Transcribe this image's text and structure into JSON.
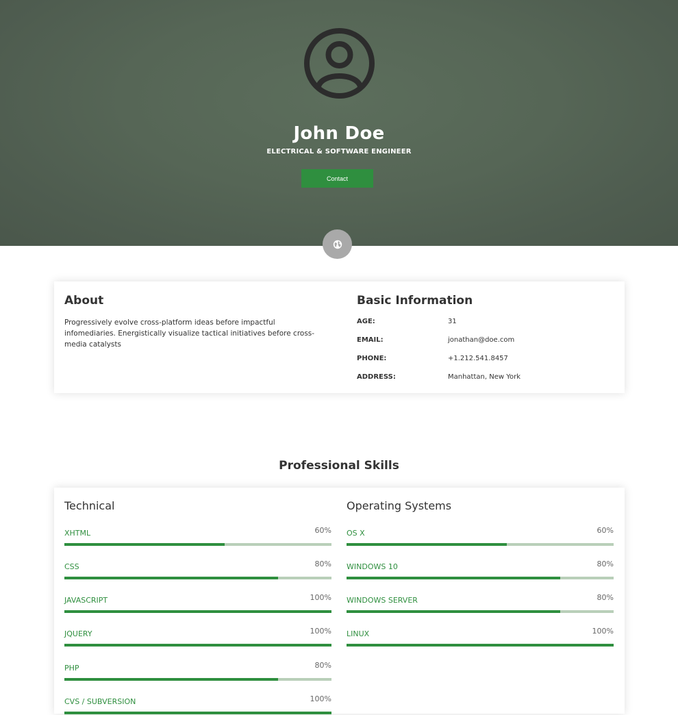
{
  "profile": {
    "name": "John Doe",
    "title": "ELECTRICAL & SOFTWARE ENGINEER",
    "contact_label": "Contact",
    "avatar_icon": "user-circle-icon",
    "globe_icon": "globe-icon"
  },
  "about": {
    "heading": "About",
    "text": "Progressively evolve cross-platform ideas before impactful infomediaries. Energistically visualize tactical initiatives before cross-media catalysts"
  },
  "basic_info": {
    "heading": "Basic Information",
    "rows": [
      {
        "label": "AGE:",
        "value": "31"
      },
      {
        "label": "EMAIL:",
        "value": "jonathan@doe.com"
      },
      {
        "label": "PHONE:",
        "value": "+1.212.541.8457"
      },
      {
        "label": "ADDRESS:",
        "value": "Manhattan, New York"
      }
    ]
  },
  "skills": {
    "heading": "Professional Skills",
    "technical": {
      "title": "Technical",
      "items": [
        {
          "name": "XHTML",
          "pct_label": "60%",
          "level": 0.6
        },
        {
          "name": "CSS",
          "pct_label": "80%",
          "level": 0.8
        },
        {
          "name": "JAVASCRIPT",
          "pct_label": "100%",
          "level": 1.0
        },
        {
          "name": "JQUERY",
          "pct_label": "100%",
          "level": 1.0
        },
        {
          "name": "PHP",
          "pct_label": "80%",
          "level": 0.8
        },
        {
          "name": "CVS / SUBVERSION",
          "pct_label": "100%",
          "level": 1.0
        }
      ]
    },
    "os": {
      "title": "Operating Systems",
      "items": [
        {
          "name": "OS X",
          "pct_label": "60%",
          "level": 0.6
        },
        {
          "name": "WINDOWS 10",
          "pct_label": "80%",
          "level": 0.8
        },
        {
          "name": "WINDOWS SERVER",
          "pct_label": "80%",
          "level": 0.8
        },
        {
          "name": "LINUX",
          "pct_label": "100%",
          "level": 1.0
        }
      ]
    }
  },
  "colors": {
    "accent": "#2f8f3f",
    "track": "#b9cfb9",
    "hero": "#566656"
  }
}
